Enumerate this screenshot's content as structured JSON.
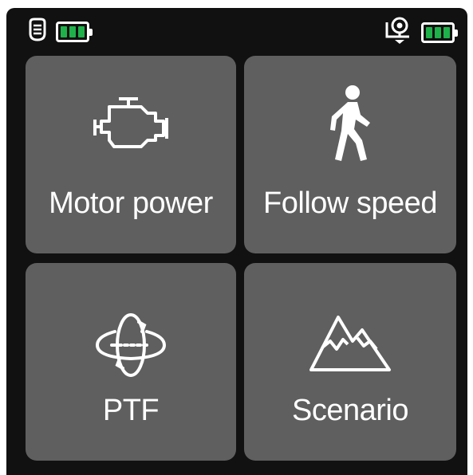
{
  "status": {
    "left_icon": "controller-icon",
    "left_battery_cells": 3,
    "right_icon": "gimbal-icon",
    "right_battery_cells": 3,
    "battery_color": "#1fb14a"
  },
  "menu": {
    "tiles": [
      {
        "label": "Motor power",
        "icon": "engine-icon"
      },
      {
        "label": "Follow speed",
        "icon": "walking-person-icon"
      },
      {
        "label": "PTF",
        "icon": "rotation-axes-icon"
      },
      {
        "label": "Scenario",
        "icon": "mountain-icon"
      }
    ]
  },
  "colors": {
    "background": "#111111",
    "tile": "#5f5f5f",
    "text": "#ffffff"
  }
}
